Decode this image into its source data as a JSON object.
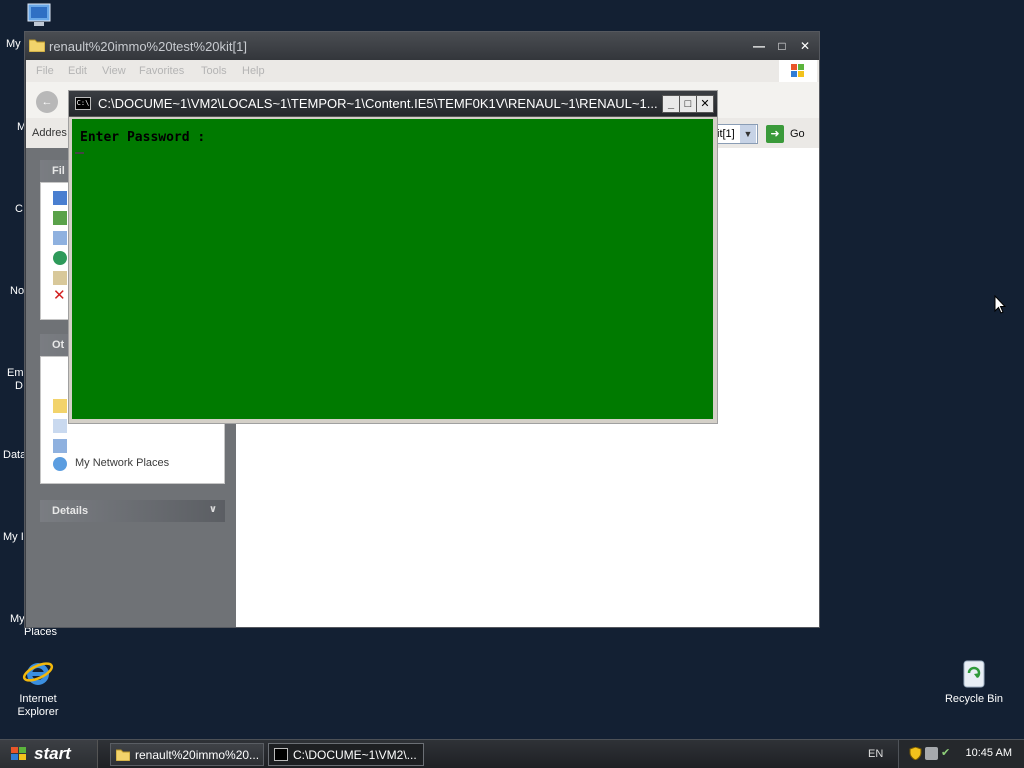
{
  "desktop": {
    "icons": {
      "my_computer": "My",
      "partial_m": "M",
      "partial_c": "C",
      "partial_no": "No",
      "partial_em": "Em",
      "partial_d": "D",
      "partial_data": "Data",
      "partial_my": "My I",
      "partial_my2": "My",
      "places": "Places",
      "internet_explorer": "Internet\nExplorer",
      "recycle_bin": "Recycle Bin"
    }
  },
  "explorer": {
    "title": "renault%20immo%20test%20kit[1]",
    "menu": [
      "File",
      "Edit",
      "View",
      "Favorites",
      "Tools",
      "Help"
    ],
    "address_label": "Addres",
    "address_value": "it[1]",
    "go_label": "Go",
    "panels": {
      "file_tasks": "Fil",
      "other_places": "Ot",
      "network_places": "My Network Places",
      "details": "Details"
    }
  },
  "console": {
    "title": "C:\\DOCUME~1\\VM2\\LOCALS~1\\TEMPOR~1\\Content.IE5\\TEMF0K1V\\RENAUL~1\\RENAUL~1....",
    "prompt": "Enter Password :",
    "icon_text": "C:\\"
  },
  "taskbar": {
    "start": "start",
    "tasks": [
      "renault%20immo%20...",
      "C:\\DOCUME~1\\VM2\\..."
    ],
    "language": "EN",
    "clock": "10:45 AM"
  }
}
